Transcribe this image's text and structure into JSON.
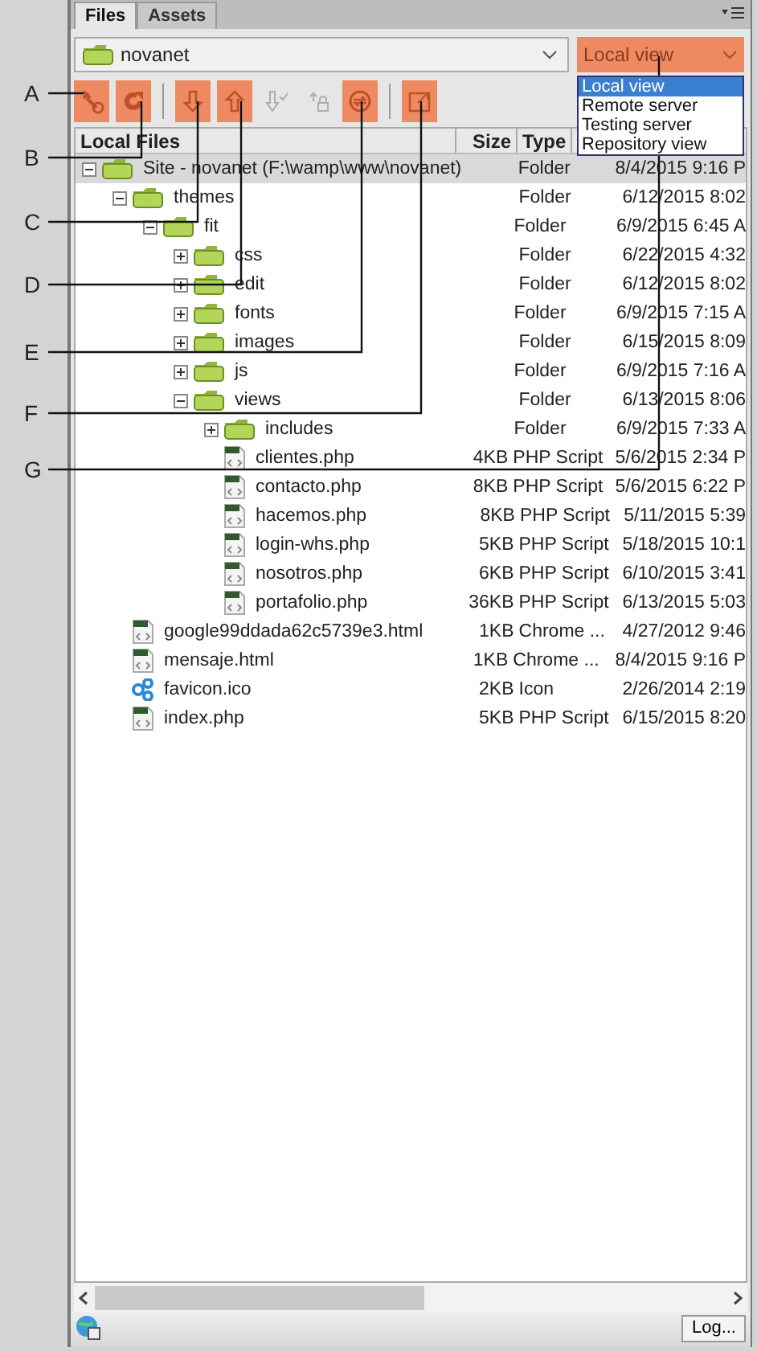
{
  "tabs": [
    {
      "label": "Files",
      "selected": true
    },
    {
      "label": "Assets",
      "selected": false
    }
  ],
  "site_select": {
    "value": "novanet"
  },
  "view_select": {
    "value": "Local view",
    "highlighted": true,
    "options": [
      {
        "label": "Local view",
        "selected": true
      },
      {
        "label": "Remote server",
        "selected": false
      },
      {
        "label": "Testing server",
        "selected": false
      },
      {
        "label": "Repository view",
        "selected": false
      }
    ]
  },
  "toolbar": [
    {
      "kind": "connect",
      "highlighted": true,
      "disabled": false
    },
    {
      "kind": "refresh",
      "highlighted": true,
      "disabled": false
    },
    {
      "kind": "separator"
    },
    {
      "kind": "get",
      "highlighted": true,
      "disabled": false
    },
    {
      "kind": "put",
      "highlighted": true,
      "disabled": false
    },
    {
      "kind": "checkin",
      "highlighted": false,
      "disabled": true
    },
    {
      "kind": "checkout",
      "highlighted": false,
      "disabled": true
    },
    {
      "kind": "sync",
      "highlighted": true,
      "disabled": false
    },
    {
      "kind": "separator"
    },
    {
      "kind": "expand",
      "highlighted": true,
      "disabled": false
    }
  ],
  "columns": [
    "Local Files",
    "Size",
    "Type"
  ],
  "tree": [
    {
      "name": "Site - novanet (F:\\wamp\\www\\novanet)",
      "type": "Folder",
      "modified": "8/4/2015 9:16 P",
      "kind": "folder",
      "expanded": true,
      "selected": true,
      "children": [
        {
          "name": "themes",
          "type": "Folder",
          "modified": "6/12/2015 8:02",
          "kind": "folder",
          "expanded": true,
          "selected": false,
          "children": [
            {
              "name": "fit",
              "type": "Folder",
              "modified": "6/9/2015 6:45 A",
              "kind": "folder",
              "expanded": true,
              "selected": false,
              "children": [
                {
                  "name": "css",
                  "type": "Folder",
                  "modified": "6/22/2015 4:32",
                  "kind": "folder",
                  "expanded": false,
                  "selected": false
                },
                {
                  "name": "edit",
                  "type": "Folder",
                  "modified": "6/12/2015 8:02",
                  "kind": "folder",
                  "expanded": false,
                  "selected": false
                },
                {
                  "name": "fonts",
                  "type": "Folder",
                  "modified": "6/9/2015 7:15 A",
                  "kind": "folder",
                  "expanded": false,
                  "selected": false
                },
                {
                  "name": "images",
                  "type": "Folder",
                  "modified": "6/15/2015 8:09",
                  "kind": "folder",
                  "expanded": false,
                  "selected": false
                },
                {
                  "name": "js",
                  "type": "Folder",
                  "modified": "6/9/2015 7:16 A",
                  "kind": "folder",
                  "expanded": false,
                  "selected": false
                },
                {
                  "name": "views",
                  "type": "Folder",
                  "modified": "6/13/2015 8:06",
                  "kind": "folder",
                  "expanded": true,
                  "selected": false,
                  "children": [
                    {
                      "name": "includes",
                      "type": "Folder",
                      "modified": "6/9/2015 7:33 A",
                      "kind": "folder",
                      "expanded": false,
                      "selected": false
                    },
                    {
                      "name": "clientes.php",
                      "size": "4KB",
                      "type": "PHP Script",
                      "modified": "5/6/2015 2:34 P",
                      "kind": "script",
                      "selected": false
                    },
                    {
                      "name": "contacto.php",
                      "size": "8KB",
                      "type": "PHP Script",
                      "modified": "5/6/2015 6:22 P",
                      "kind": "script",
                      "selected": false
                    },
                    {
                      "name": "hacemos.php",
                      "size": "8KB",
                      "type": "PHP Script",
                      "modified": "5/11/2015 5:39",
                      "kind": "script",
                      "selected": false
                    },
                    {
                      "name": "login-whs.php",
                      "size": "5KB",
                      "type": "PHP Script",
                      "modified": "5/18/2015 10:1",
                      "kind": "script",
                      "selected": false
                    },
                    {
                      "name": "nosotros.php",
                      "size": "6KB",
                      "type": "PHP Script",
                      "modified": "6/10/2015 3:41",
                      "kind": "script",
                      "selected": false
                    },
                    {
                      "name": "portafolio.php",
                      "size": "36KB",
                      "type": "PHP Script",
                      "modified": "6/13/2015 5:03",
                      "kind": "script",
                      "selected": false
                    }
                  ]
                }
              ]
            }
          ]
        },
        {
          "name": "google99ddada62c5739e3.html",
          "size": "1KB",
          "type": "Chrome ...",
          "modified": "4/27/2012 9:46",
          "kind": "script",
          "selected": false
        },
        {
          "name": "mensaje.html",
          "size": "1KB",
          "type": "Chrome ...",
          "modified": "8/4/2015 9:16 P",
          "kind": "script",
          "selected": false
        },
        {
          "name": "favicon.ico",
          "size": "2KB",
          "type": "Icon",
          "modified": "2/26/2014 2:19",
          "kind": "icon",
          "selected": false
        },
        {
          "name": "index.php",
          "size": "5KB",
          "type": "PHP Script",
          "modified": "6/15/2015 8:20",
          "kind": "script",
          "selected": false
        }
      ]
    }
  ],
  "status_bar": {
    "log_button": "Log..."
  },
  "callouts": [
    {
      "label": "A"
    },
    {
      "label": "B"
    },
    {
      "label": "C"
    },
    {
      "label": "D"
    },
    {
      "label": "E"
    },
    {
      "label": "F"
    },
    {
      "label": "G"
    }
  ]
}
